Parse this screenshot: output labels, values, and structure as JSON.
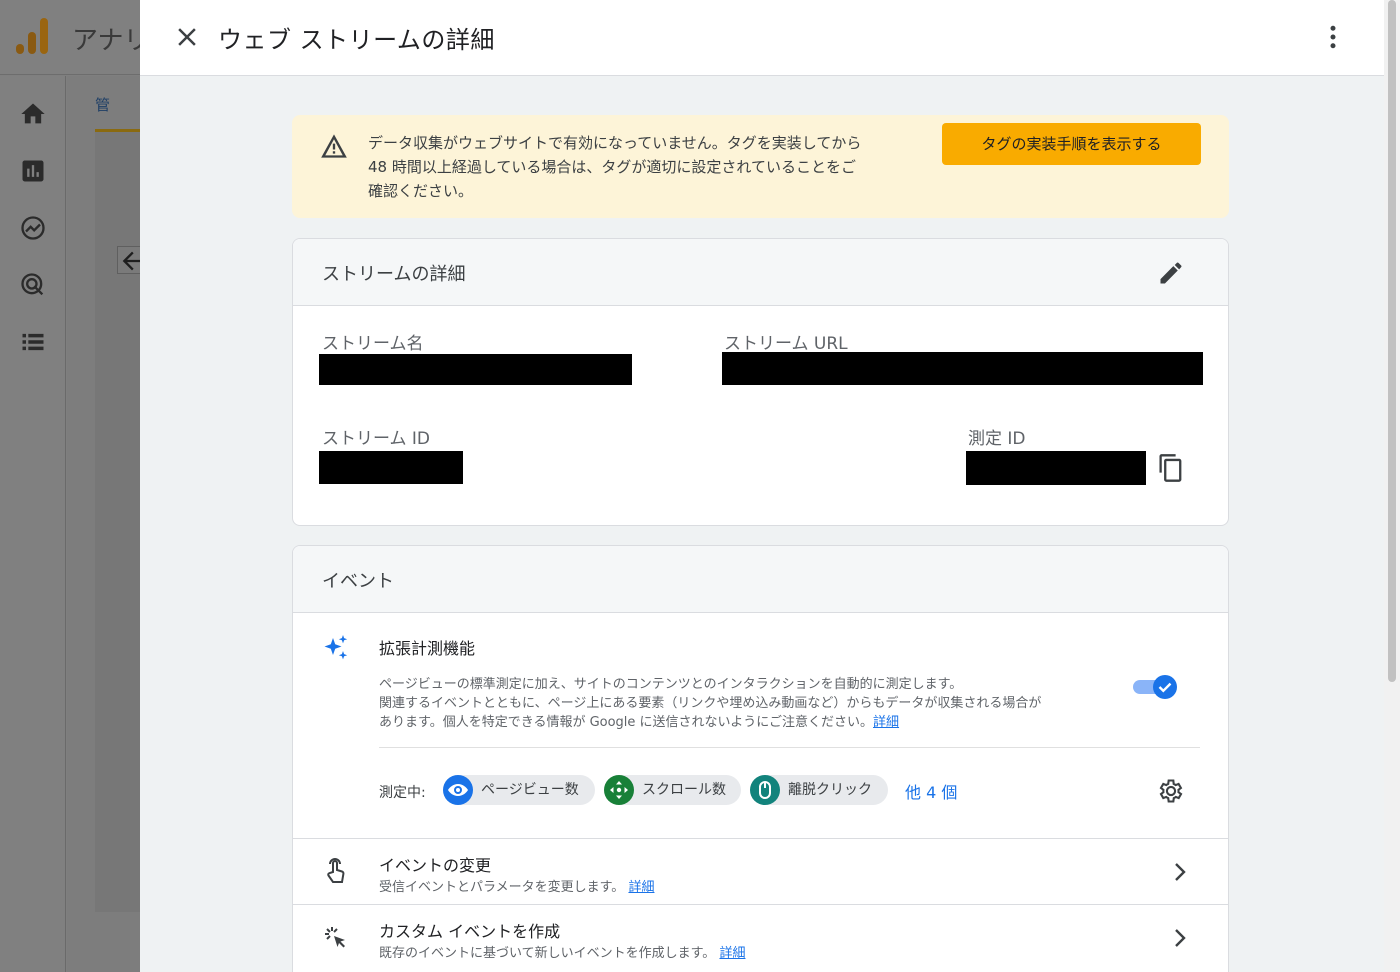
{
  "app": {
    "title": "アナリ"
  },
  "background": {
    "tab_label": "管"
  },
  "drawer": {
    "title": "ウェブ ストリームの詳細",
    "close_icon": "close-icon",
    "more_icon": "more-vert-icon"
  },
  "banner": {
    "icon": "warning-icon",
    "text_line1": "データ収集がウェブサイトで有効になっていません。タグを実装してから",
    "text_line2": "48 時間以上経過している場合は、タグが適切に設定されていることをご",
    "text_line3": "確認ください。",
    "button_label": "タグの実装手順を表示する"
  },
  "stream_details": {
    "title": "ストリームの詳細",
    "edit_icon": "edit-pencil-icon",
    "stream_name_label": "ストリーム名",
    "stream_url_label": "ストリーム URL",
    "stream_id_label": "ストリーム ID",
    "measurement_id_label": "測定 ID",
    "copy_icon": "copy-icon"
  },
  "events": {
    "title": "イベント",
    "enhanced": {
      "icon": "sparkle-icon",
      "title": "拡張計測機能",
      "desc_line1": "ページビューの標準測定に加え、サイトのコンテンツとのインタラクションを自動的に測定します。",
      "desc_line2": "関連するイベントとともに、ページ上にある要素（リンクや埋め込み動画など）からもデータが収集される場合が",
      "desc_line3": "あります。個人を特定できる情報が Google に送信されないようにご注意ください。",
      "desc_link": "詳細",
      "toggle_on": true,
      "measuring_label": "測定中:",
      "chips": [
        {
          "label": "ページビュー数",
          "icon": "eye-icon",
          "color": "#1a73e8"
        },
        {
          "label": "スクロール数",
          "icon": "scroll-arrows-icon",
          "color": "#188038"
        },
        {
          "label": "離脱クリック",
          "icon": "mouse-icon",
          "color": "#12837c"
        }
      ],
      "more_label": "他 4 個",
      "settings_icon": "gear-icon"
    },
    "rows": [
      {
        "title": "イベントの変更",
        "subtitle": "受信イベントとパラメータを変更します。",
        "link": "詳細",
        "icon": "touch-icon"
      },
      {
        "title": "カスタム イベントを作成",
        "subtitle": "既存のイベントに基づいて新しいイベントを作成します。",
        "link": "詳細",
        "icon": "click-sparkle-icon"
      }
    ]
  },
  "colors": {
    "accent": "#1a73e8",
    "banner_bg": "#fdf4d8",
    "banner_button": "#f9ab00",
    "redaction": "#000000"
  }
}
